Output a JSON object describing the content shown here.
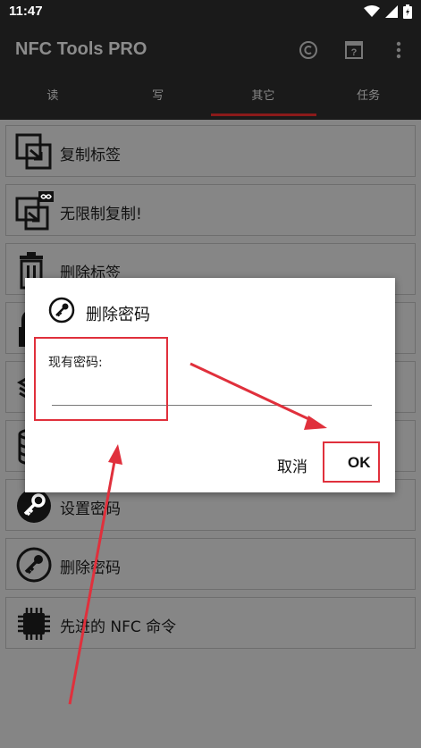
{
  "status": {
    "time": "11:47"
  },
  "appbar": {
    "title": "NFC Tools PRO",
    "actions": [
      "copyright-icon",
      "help-box-icon",
      "more-vert-icon"
    ]
  },
  "tabs": [
    {
      "label": "读",
      "active": false
    },
    {
      "label": "写",
      "active": false
    },
    {
      "label": "其它",
      "active": true
    },
    {
      "label": "任务",
      "active": false
    }
  ],
  "list": {
    "items": [
      {
        "label": "复制标签",
        "icon": "copy-tag-icon"
      },
      {
        "label": "无限制复制!",
        "icon": "unlimited-copy-icon"
      },
      {
        "label": "删除标签",
        "icon": "trash-icon"
      },
      {
        "label": "",
        "icon": "lock-icon"
      },
      {
        "label": "",
        "icon": "layers-icon"
      },
      {
        "label": "",
        "icon": "database-icon"
      },
      {
        "label": "设置密码",
        "icon": "set-password-key-icon"
      },
      {
        "label": "删除密码",
        "icon": "remove-password-key-icon"
      },
      {
        "label": "先进的 NFC 命令",
        "icon": "chip-icon"
      }
    ]
  },
  "dialog": {
    "title": "删除密码",
    "icon": "key-icon",
    "field_label": "现有密码:",
    "field_value": "",
    "cancel_label": "取消",
    "ok_label": "OK"
  },
  "colors": {
    "appbar": "#1a1a1a",
    "dim_background": "#858585",
    "tab_indicator": "#8b1a1a",
    "annotation_red": "#e0303c"
  }
}
